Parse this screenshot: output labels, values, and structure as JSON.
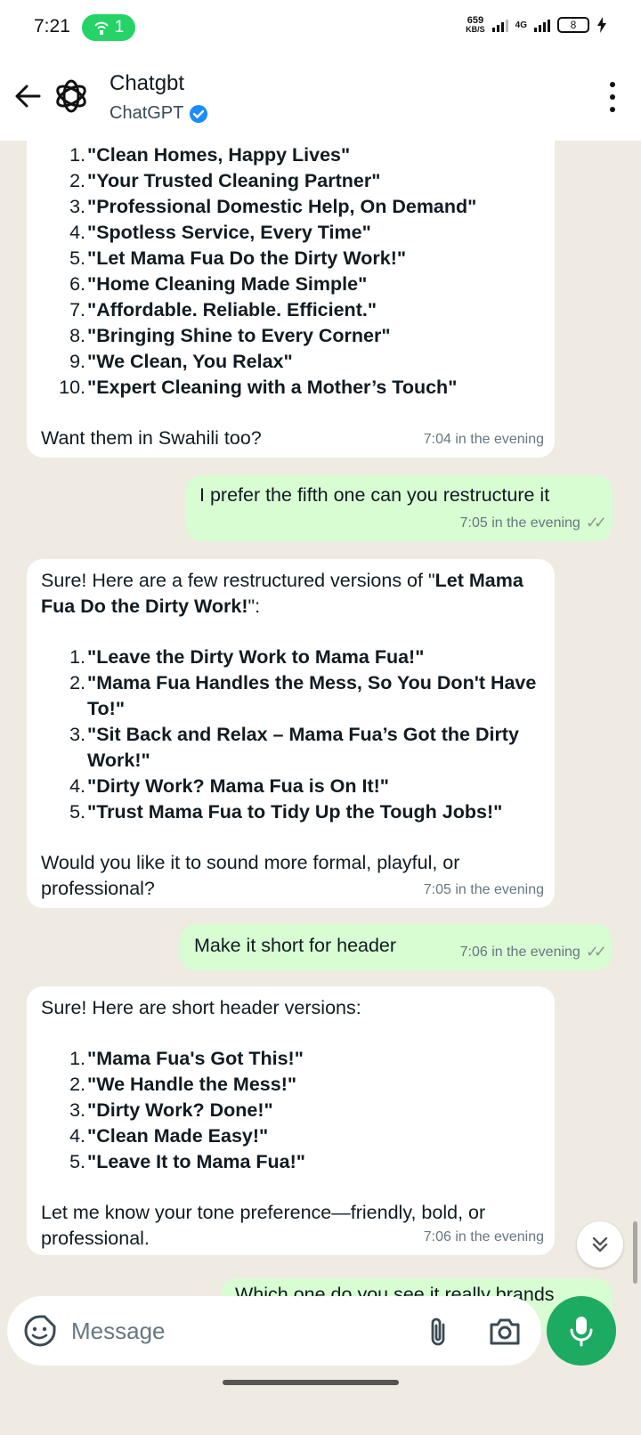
{
  "status": {
    "time": "7:21",
    "hotspot_count": "1",
    "net_speed": "659",
    "net_unit": "KB/S",
    "network": "4G",
    "battery": "8"
  },
  "header": {
    "title": "Chatgbt",
    "subtitle": "ChatGPT"
  },
  "messages": [
    {
      "items": [
        {
          "n": "1.",
          "t": "\"Clean Homes, Happy Lives\""
        },
        {
          "n": "2.",
          "t": "\"Your Trusted Cleaning Partner\""
        },
        {
          "n": "3.",
          "t": "\"Professional Domestic Help, On Demand\""
        },
        {
          "n": "4.",
          "t": "\"Spotless Service, Every Time\""
        },
        {
          "n": "5.",
          "t": "\"Let Mama Fua Do the Dirty Work!\""
        },
        {
          "n": "6.",
          "t": "\"Home Cleaning Made Simple\""
        },
        {
          "n": "7.",
          "t": "\"Affordable. Reliable. Efficient.\""
        },
        {
          "n": "8.",
          "t": "\"Bringing Shine to Every Corner\""
        },
        {
          "n": "9.",
          "t": "\"We Clean, You Relax\""
        },
        {
          "n": "10.",
          "t": "\"Expert Cleaning with a Mother’s Touch\""
        }
      ],
      "outro": "Want them in Swahili too?",
      "time": "7:04 in the evening"
    },
    {
      "text": "I prefer the fifth one can you restructure it",
      "time": "7:05 in the evening"
    },
    {
      "intro_prefix": "Sure! Here are a few restructured versions of \"",
      "intro_bold": "Let Mama Fua Do the Dirty Work!",
      "intro_suffix": "\":",
      "items": [
        {
          "n": "1.",
          "t": "\"Leave the Dirty Work to Mama Fua!\""
        },
        {
          "n": "2.",
          "t": "\"Mama Fua Handles the Mess, So You Don't Have To!\""
        },
        {
          "n": "3.",
          "t": "\"Sit Back and Relax – Mama Fua’s Got the Dirty Work!\""
        },
        {
          "n": "4.",
          "t": "\"Dirty Work? Mama Fua is On It!\""
        },
        {
          "n": "5.",
          "t": "\"Trust Mama Fua to Tidy Up the Tough Jobs!\""
        }
      ],
      "outro": "Would you like it to sound more formal, playful, or professional?",
      "time": "7:05 in the evening"
    },
    {
      "text": "Make it short for header",
      "time": "7:06 in the evening"
    },
    {
      "intro": "Sure! Here are short header versions:",
      "items": [
        {
          "n": "1.",
          "t": "\"Mama Fua's Got This!\""
        },
        {
          "n": "2.",
          "t": "\"We Handle the Mess!\""
        },
        {
          "n": "3.",
          "t": "\"Dirty Work? Done!\""
        },
        {
          "n": "4.",
          "t": "\"Clean Made Easy!\""
        },
        {
          "n": "5.",
          "t": "\"Leave It to Mama Fua!\""
        }
      ],
      "outro": "Let me know your tone preference—friendly, bold, or professional.",
      "time": "7:06 in the evening"
    },
    {
      "text": "Which one do you see it really brands"
    }
  ],
  "composer": {
    "placeholder": "Message"
  },
  "colors": {
    "incoming_bubble": "#ffffff",
    "outgoing_bubble": "#d9fdd3",
    "mic_button": "#1daa61",
    "chat_background": "#efeae2"
  }
}
